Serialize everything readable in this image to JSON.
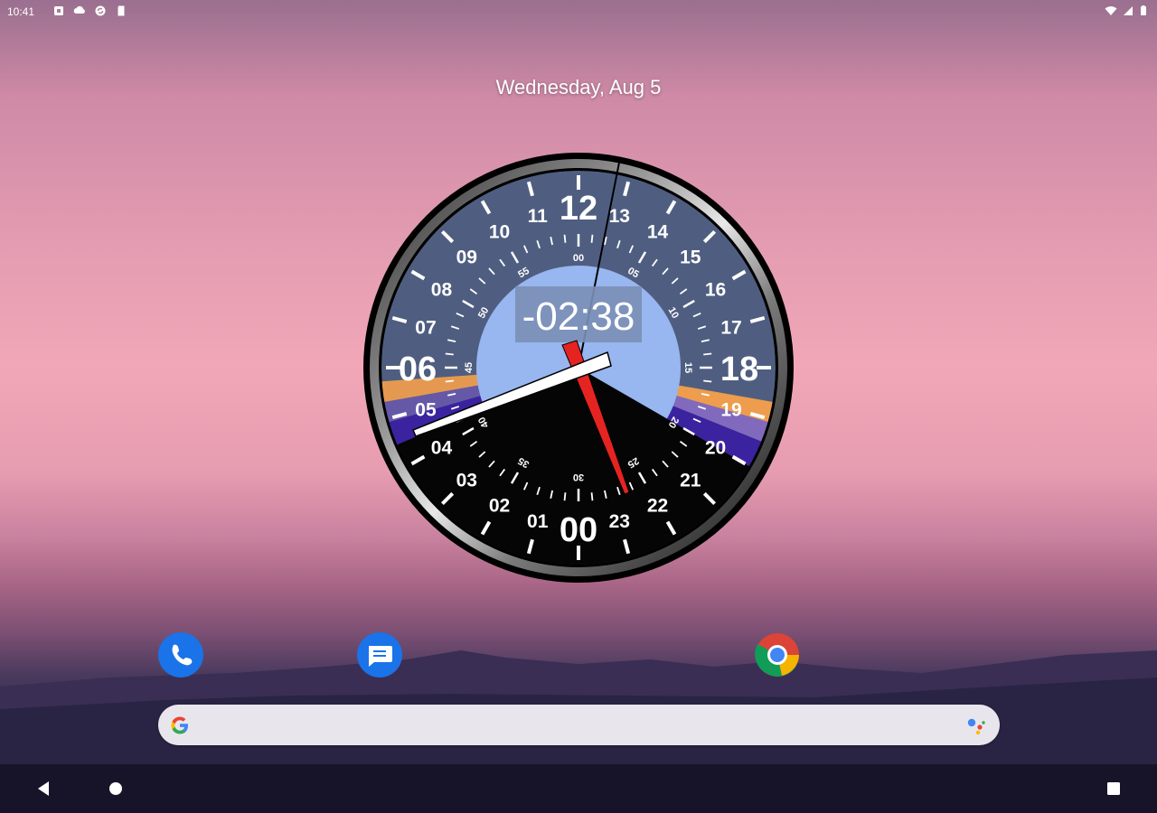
{
  "status_bar": {
    "time": "10:41",
    "left_icons": [
      "notification-square-icon",
      "cloud-icon",
      "sync-icon",
      "sd-card-icon"
    ],
    "right_icons": [
      "wifi-icon",
      "signal-icon",
      "battery-icon"
    ]
  },
  "home": {
    "date_label": "Wednesday, Aug 5"
  },
  "clock_widget": {
    "digital_display": "-02:38",
    "hour_labels": [
      "00",
      "01",
      "02",
      "03",
      "04",
      "05",
      "06",
      "07",
      "08",
      "09",
      "10",
      "11",
      "12",
      "13",
      "14",
      "15",
      "16",
      "17",
      "18",
      "19",
      "20",
      "21",
      "22",
      "23"
    ],
    "minute_labels": [
      "00",
      "05",
      "10",
      "15",
      "20",
      "25",
      "30",
      "35",
      "40",
      "45",
      "50",
      "55"
    ],
    "colors": {
      "day_dial": "#4f5e80",
      "night_dial": "#050505",
      "center_sky": "#98b6ef",
      "hour_hand": "#e52421",
      "minute_hand": "#ffffff",
      "twilight_orange": "#f5a04a",
      "twilight_purple": "#3a1fa0"
    }
  },
  "dock": {
    "apps": [
      {
        "name": "Phone",
        "icon": "phone-icon",
        "color": "#1a73e8"
      },
      {
        "name": "Messages",
        "icon": "messages-icon",
        "color": "#1a73e8"
      },
      {
        "name": "Chrome",
        "icon": "chrome-icon",
        "color": "#ffffff"
      }
    ]
  },
  "search": {
    "placeholder": "",
    "left_icon": "google-logo-icon",
    "right_icon": "google-assistant-icon"
  },
  "navigation": {
    "buttons": [
      "back-icon",
      "home-icon",
      "recents-icon"
    ]
  }
}
